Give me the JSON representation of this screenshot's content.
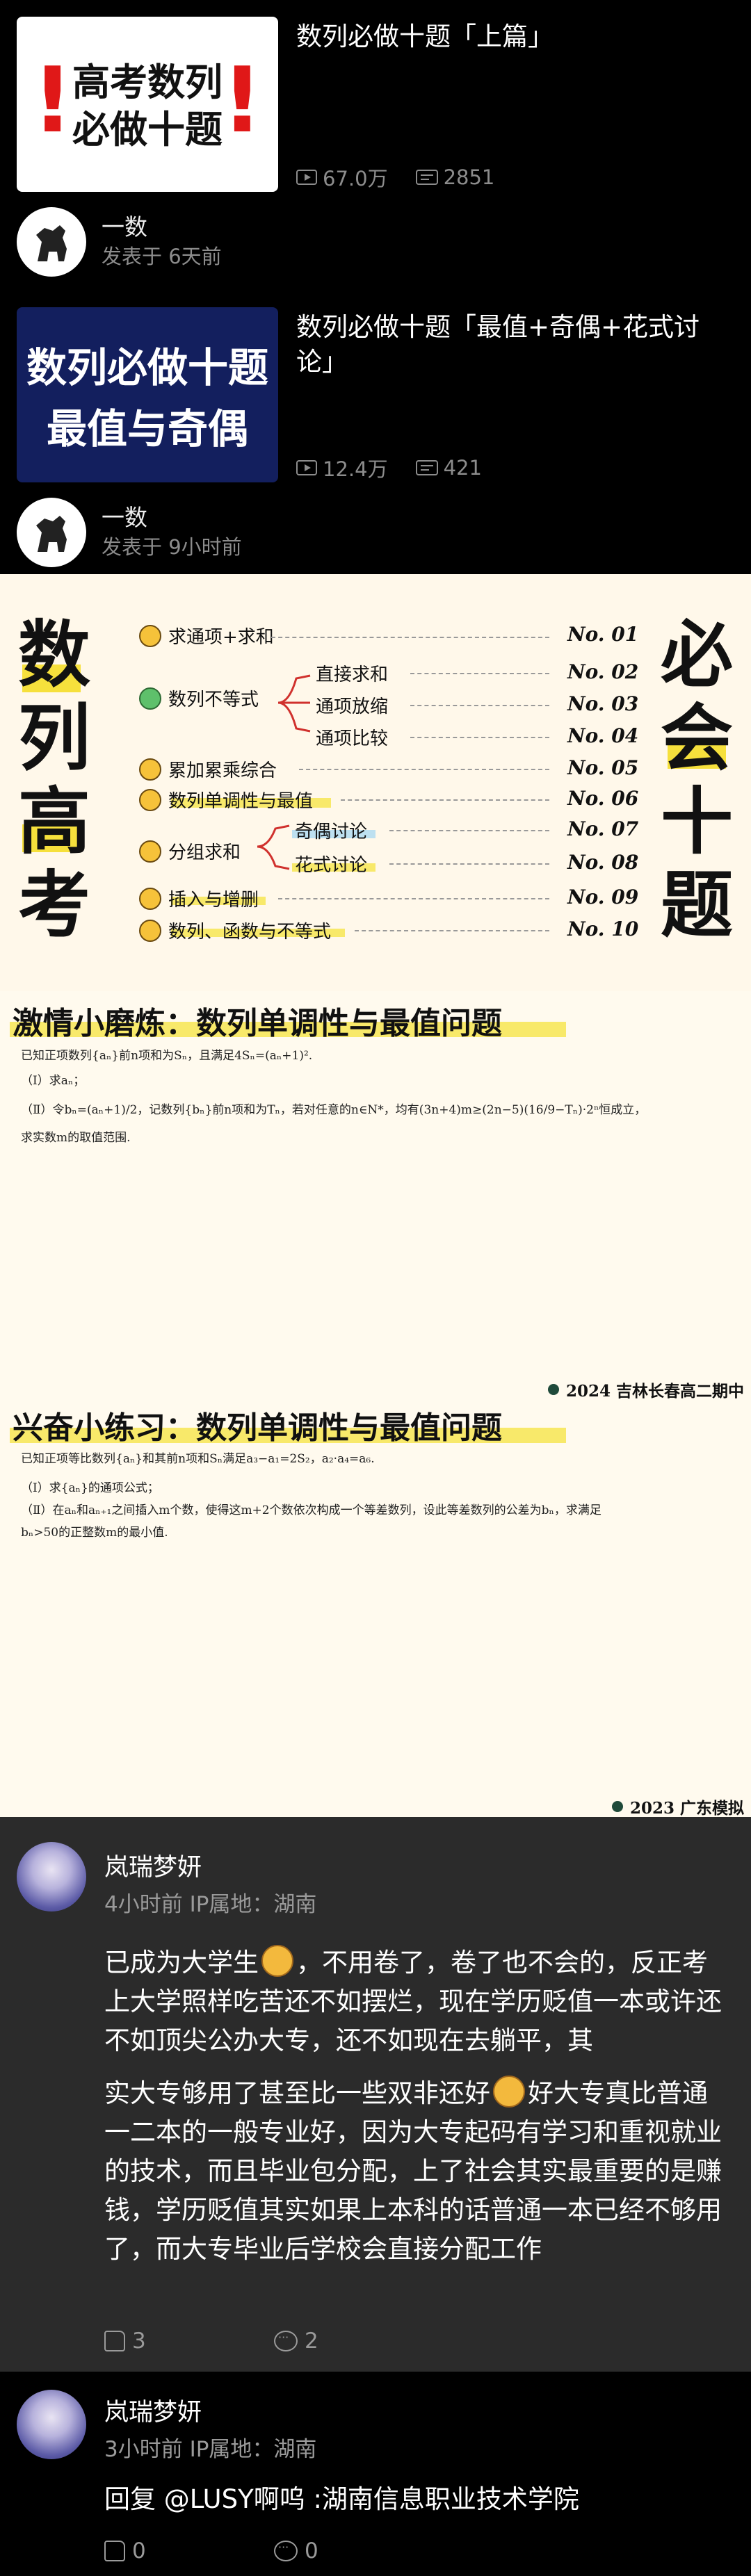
{
  "videos": [
    {
      "thumb_text": [
        "高考数列",
        "必做十题"
      ],
      "thumb_marks": [
        "!",
        "!"
      ],
      "title": "数列必做十题「上篇」",
      "views": "67.0万",
      "danmaku": "2851",
      "author": "一数",
      "posted": "发表于 6天前"
    },
    {
      "thumb_text": [
        "数列必做十题",
        "最值与奇偶"
      ],
      "title": "数列必做十题「最值+奇偶+花式讨论」",
      "views": "12.4万",
      "danmaku": "421",
      "author": "一数",
      "posted": "发表于 9小时前"
    }
  ],
  "poster": {
    "left_chars": [
      "数",
      "列",
      "高",
      "考"
    ],
    "right_chars": [
      "必",
      "会",
      "十",
      "题"
    ],
    "items": [
      {
        "label": "求通项+求和",
        "no": "No. 01"
      },
      {
        "label": "数列不等式",
        "sub": [
          "直接求和",
          "通项放缩",
          "通项比较"
        ],
        "nos": [
          "No. 02",
          "No. 03",
          "No. 04"
        ]
      },
      {
        "label": "累加累乘综合",
        "no": "No. 05"
      },
      {
        "label": "数列单调性与最值",
        "no": "No. 06"
      },
      {
        "label": "分组求和",
        "sub": [
          "奇偶讨论",
          "花式讨论"
        ],
        "nos": [
          "No. 07",
          "No. 08"
        ]
      },
      {
        "label": "插入与增删",
        "no": "No. 09"
      },
      {
        "label": "数列、函数与不等式",
        "no": "No. 10"
      }
    ]
  },
  "problem1": {
    "title": "激情小磨炼：数列单调性与最值问题",
    "lines": [
      "已知正项数列{aₙ}前n项和为Sₙ，且满足4Sₙ=(aₙ+1)².",
      "（Ⅰ）求aₙ；",
      "（Ⅱ）令bₙ=(aₙ+1)/2，记数列{bₙ}前n项和为Tₙ，若对任意的n∈N*，均有(3n+4)m≥(2n−5)(16/9−Tₙ)·2ⁿ恒成立，",
      "求实数m的取值范围."
    ],
    "source": "2024 吉林长春高二期中"
  },
  "problem2": {
    "title": "兴奋小练习：数列单调性与最值问题",
    "lines": [
      "已知正项等比数列{aₙ}和其前n项和Sₙ满足a₃−a₁=2S₂，a₂·a₄=a₆.",
      "（Ⅰ）求{aₙ}的通项公式；",
      "（Ⅱ）在aₙ和aₙ₊₁之间插入m个数，使得这m+2个数依次构成一个等差数列，设此等差数列的公差为bₙ，求满足",
      "bₙ>50的正整数m的最小值."
    ],
    "source": "2023 广东模拟"
  },
  "comments": [
    {
      "name": "岚瑞梦妍",
      "meta": "4小时前   IP属地：湖南",
      "body_a": "已成为大学生",
      "body_b": "，不用卷了，卷了也不会的，反正考上大学照样吃苦还不如摆烂，现在学历贬值一本或许还不如顶尖公办大专，还不如现在去躺平，其",
      "body_c": "实大专够用了甚至比一些双非还好",
      "body_d": "好大专真比普通一二本的一般专业好，因为大专起码有学习和重视就业的技术，而且毕业包分配，上了社会其实最重要的是赚钱，学历贬值其实如果上本科的话普通一本已经不够用了，而大专毕业后学校会直接分配工作",
      "likes": "3",
      "replies": "2"
    },
    {
      "name": "岚瑞梦妍",
      "meta": "3小时前   IP属地：湖南",
      "body": "回复 @LUSY啊呜 :湖南信息职业技术学院",
      "likes": "0",
      "replies": "0"
    }
  ]
}
